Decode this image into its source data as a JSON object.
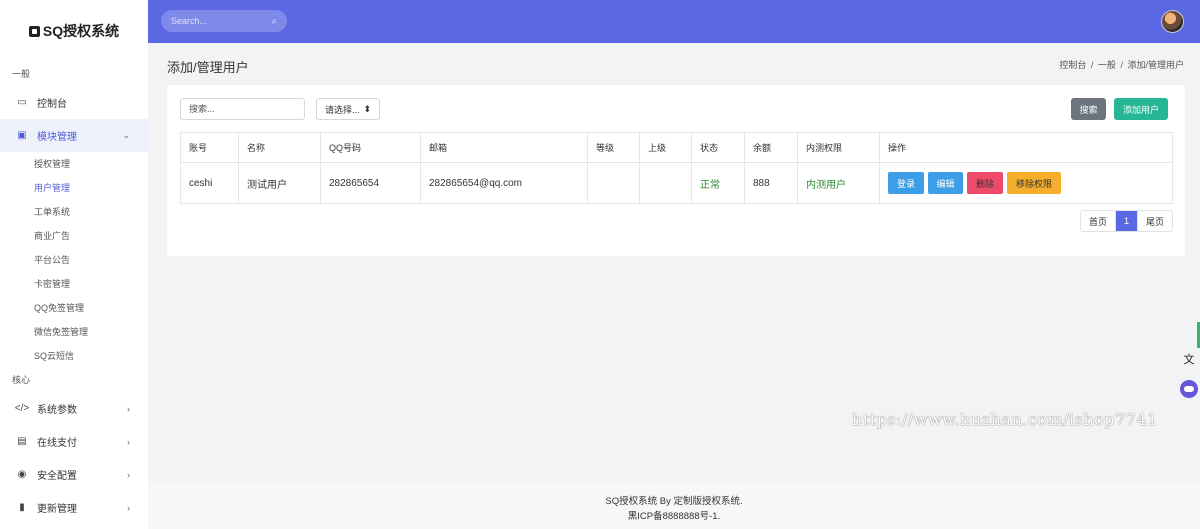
{
  "brand": {
    "name": "SQ授权系统",
    "icon": "box-icon"
  },
  "sidebar": {
    "section_general": "一般",
    "section_core": "核心",
    "items_general": [
      {
        "label": "控制台",
        "icon": "monitor-icon"
      },
      {
        "label": "模块管理",
        "icon": "module-icon",
        "active": true
      }
    ],
    "sub_items": [
      {
        "label": "授权管理"
      },
      {
        "label": "用户管理",
        "current": true
      },
      {
        "label": "工单系统"
      },
      {
        "label": "商业广告"
      },
      {
        "label": "平台公告"
      },
      {
        "label": "卡密管理"
      },
      {
        "label": "QQ免签管理"
      },
      {
        "label": "微信免签管理"
      },
      {
        "label": "SQ云短信"
      }
    ],
    "items_core": [
      {
        "label": "系统参数",
        "icon": "code-icon"
      },
      {
        "label": "在线支付",
        "icon": "payment-icon"
      },
      {
        "label": "安全配置",
        "icon": "fingerprint-icon"
      },
      {
        "label": "更新管理",
        "icon": "file-icon"
      }
    ]
  },
  "topbar": {
    "search_placeholder": "Search..."
  },
  "page": {
    "title": "添加/管理用户",
    "breadcrumb": [
      "控制台",
      "一般",
      "添加/管理用户"
    ]
  },
  "filters": {
    "search_placeholder": "搜索...",
    "select_value": "请选择...",
    "search_button": "搜索",
    "add_button": "添加用户"
  },
  "table": {
    "headers": [
      "账号",
      "名称",
      "QQ号码",
      "邮箱",
      "等级",
      "上级",
      "状态",
      "余额",
      "内测权限",
      "操作"
    ],
    "rows": [
      {
        "account": "ceshi",
        "name": "测试用户",
        "qq": "282865654",
        "email": "282865654@qq.com",
        "level": "",
        "parent": "",
        "status": "正常",
        "balance": "888",
        "beta": "内测用户",
        "actions": {
          "login": "登录",
          "edit": "编辑",
          "delete": "删除",
          "remove": "移除权限"
        }
      }
    ]
  },
  "pager": {
    "first": "首页",
    "current": "1",
    "last": "尾页"
  },
  "watermark": "https://www.huzhan.com/ishop7741",
  "footer": {
    "line1": "SQ授权系统 By 定制版授权系统.",
    "line2": "黑ICP备8888888号-1."
  },
  "colors": {
    "primary": "#5b68e4",
    "success": "#26b595",
    "danger": "#ee4b6b",
    "warning": "#f6ae2d",
    "info": "#3c9ee6"
  }
}
